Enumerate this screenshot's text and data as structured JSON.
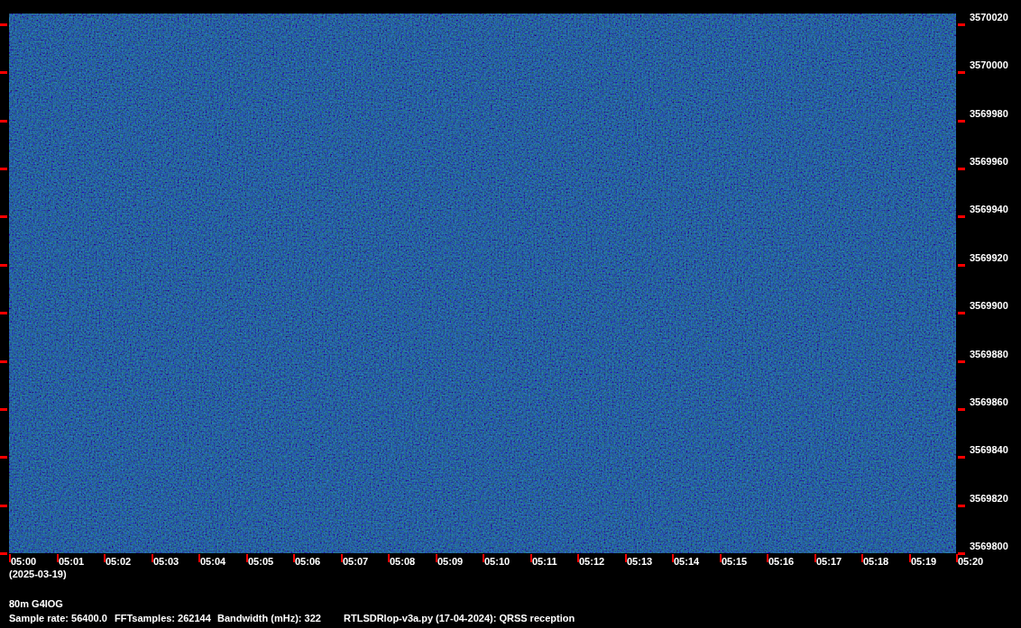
{
  "frequency_axis": {
    "labels": [
      "3570020",
      "3570000",
      "3569980",
      "3569960",
      "3569940",
      "3569920",
      "3569900",
      "3569880",
      "3569860",
      "3569840",
      "3569820",
      "3569800"
    ]
  },
  "time_axis": {
    "labels": [
      "05:00",
      "05:01",
      "05:02",
      "05:03",
      "05:04",
      "05:05",
      "05:06",
      "05:07",
      "05:08",
      "05:09",
      "05:10",
      "05:11",
      "05:12",
      "05:13",
      "05:14",
      "05:15",
      "05:16",
      "05:17",
      "05:18",
      "05:19",
      "05:20"
    ],
    "date": "(2025-03-19)"
  },
  "footer": {
    "station": "80m G4IOG",
    "info": [
      "Sample rate: 56400.0",
      "FFTsamples: 262144",
      "Bandwidth (mHz): 322",
      "RTLSDRlop-v3a.py (17-04-2024): QRSS reception"
    ]
  }
}
